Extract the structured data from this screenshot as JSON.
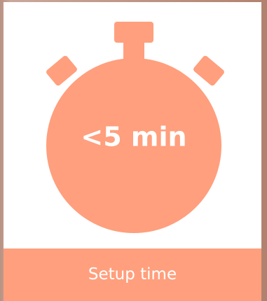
{
  "card": {
    "value_text": "<5 min",
    "label": "Setup time",
    "icon": "stopwatch-icon"
  },
  "colors": {
    "accent": "#ff9f7d",
    "text": "#ffffff",
    "card_background": "#ffffff"
  }
}
